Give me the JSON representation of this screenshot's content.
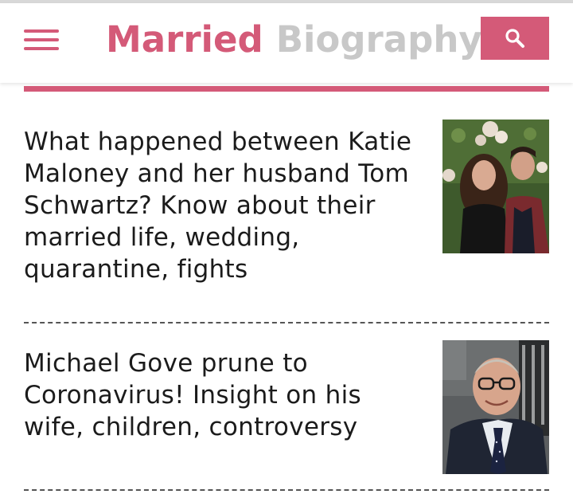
{
  "site": {
    "logo_word1": "Married",
    "logo_word2": "Biography",
    "brand_color": "#d45a78",
    "muted_color": "#c8c8c8"
  },
  "header": {
    "menu_icon": "hamburger-menu-icon",
    "search_icon": "search-icon"
  },
  "articles": [
    {
      "title": "What happened between Katie Maloney and her husband Tom Schwartz? Know about their married life, wedding, quarantine, fights",
      "thumbnail": "couple-photo"
    },
    {
      "title": "Michael Gove prune to Coronavirus! Insight on his wife, children, controversy",
      "thumbnail": "man-portrait-photo"
    }
  ]
}
